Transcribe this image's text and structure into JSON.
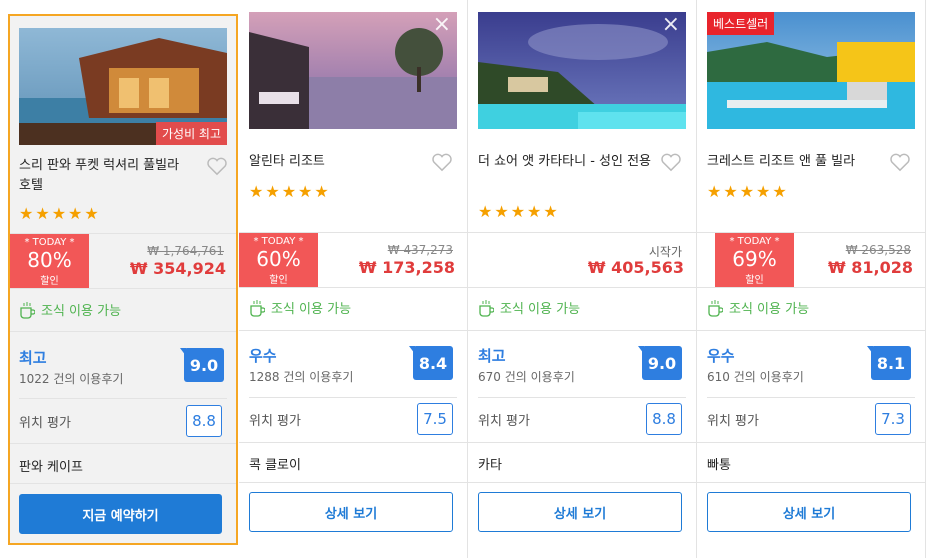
{
  "hotels": [
    {
      "badge": "가성비 최고",
      "name": "스리 판와 푸켓 럭셔리 풀빌라 호텔",
      "stars": "★★★★★",
      "today_label": "* TODAY *",
      "discount": "80%",
      "discount_label": "할인",
      "price_old": "₩ 1,764,761",
      "price_new": "₩ 354,924",
      "breakfast": "조식 이용 가능",
      "grade": "최고",
      "reviews": "1022 건의 이용후기",
      "score": "9.0",
      "location_label": "위치 평가",
      "location_score": "8.8",
      "area": "판와 케이프",
      "button": "지금 예약하기"
    },
    {
      "name": "알린타 리조트",
      "stars": "★★★★★",
      "today_label": "* TODAY *",
      "discount": "60%",
      "discount_label": "할인",
      "price_old": "₩ 437,273",
      "price_new": "₩ 173,258",
      "breakfast": "조식 이용 가능",
      "grade": "우수",
      "reviews": "1288 건의 이용후기",
      "score": "8.4",
      "location_label": "위치 평가",
      "location_score": "7.5",
      "area": "콕 클로이",
      "button": "상세 보기"
    },
    {
      "name": "더 쇼어 앳 카타타니 - 성인 전용",
      "stars": "★★★★★",
      "price_start": "시작가",
      "price_new": "₩ 405,563",
      "breakfast": "조식 이용 가능",
      "grade": "최고",
      "reviews": "670 건의 이용후기",
      "score": "9.0",
      "location_label": "위치 평가",
      "location_score": "8.8",
      "area": "카타",
      "button": "상세 보기"
    },
    {
      "badge": "베스트셀러",
      "name": "크레스트 리조트 앤 풀 빌라",
      "stars": "★★★★★",
      "today_label": "* TODAY *",
      "discount": "69%",
      "discount_label": "할인",
      "price_old": "₩ 263,528",
      "price_new": "₩ 81,028",
      "breakfast": "조식 이용 가능",
      "grade": "우수",
      "reviews": "610 건의 이용후기",
      "score": "8.1",
      "location_label": "위치 평가",
      "location_score": "7.3",
      "area": "빠통",
      "button": "상세 보기"
    }
  ],
  "icons": {
    "close": "close-icon",
    "heart": "heart-icon",
    "coffee": "coffee-cup-icon"
  },
  "colors": {
    "accent_blue": "#2e7ee0",
    "discount_red": "#f25757",
    "price_red": "#e03c3c",
    "star_orange": "#f5a000",
    "breakfast_green": "#4fb34f",
    "selected_border": "#f5a623"
  }
}
